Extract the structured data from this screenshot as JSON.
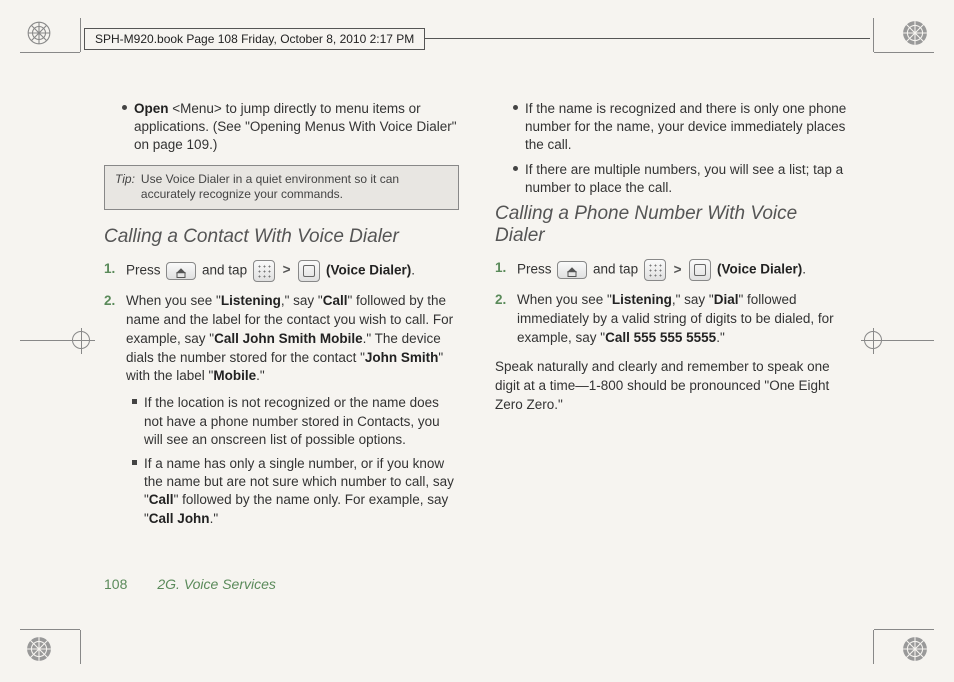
{
  "header": {
    "text": "SPH-M920.book  Page 108  Friday, October 8, 2010  2:17 PM"
  },
  "col1": {
    "bullet_open": {
      "pre": "Open ",
      "mid": "<Menu>",
      "post": " to jump directly to menu items or applications. (See \"Opening Menus With Voice Dialer\" on page 109.)"
    },
    "tip": {
      "label": "Tip:",
      "text": "Use Voice Dialer in a quiet environment so it can accurately recognize your commands."
    },
    "heading": "Calling a Contact With Voice Dialer",
    "step1": {
      "pre": "Press ",
      "mid1": " and tap ",
      "gt": ">",
      "post": "(Voice Dialer)",
      "end": "."
    },
    "step2": {
      "a": "When you see \"",
      "b": "Listening",
      "c": ",\" say \"",
      "d": "Call",
      "e": "\" followed by the name and the label for the contact you wish to call. For example, say \"",
      "f": "Call John Smith Mobile",
      "g": ".\" The device dials the number stored for the contact \"",
      "h": "John Smith",
      "i": "\" with the label \"",
      "j": "Mobile",
      "k": ".\""
    },
    "sub1": "If the location is not recognized or the name does not have a phone number stored in Contacts, you will see an onscreen list of possible options.",
    "sub2": {
      "a": "If a name has only a single number, or if you know the name but are not sure which number to call, say \"",
      "b": "Call",
      "c": "\" followed by the name only. For example, say \"",
      "d": "Call John",
      "e": ".\""
    }
  },
  "col2": {
    "bullet1": "If the name is recognized and there is only one phone number for the name, your device immediately places the call.",
    "bullet2": "If there are multiple numbers, you will see a list; tap a number to place the call.",
    "heading": "Calling a Phone Number With Voice Dialer",
    "step1": {
      "pre": "Press ",
      "mid1": " and tap ",
      "gt": ">",
      "post": "(Voice Dialer)",
      "end": "."
    },
    "step2": {
      "a": "When you see \"",
      "b": "Listening",
      "c": ",\" say \"",
      "d": "Dial",
      "e": "\" followed immediately by a valid string of digits to be dialed, for example, say \"",
      "f": "Call 555 555 5555",
      "g": ".\""
    },
    "para": "Speak naturally and clearly and remember to speak one digit at a time—1-800 should be pronounced \"One Eight Zero Zero.\""
  },
  "footer": {
    "page": "108",
    "section": "2G. Voice Services"
  }
}
